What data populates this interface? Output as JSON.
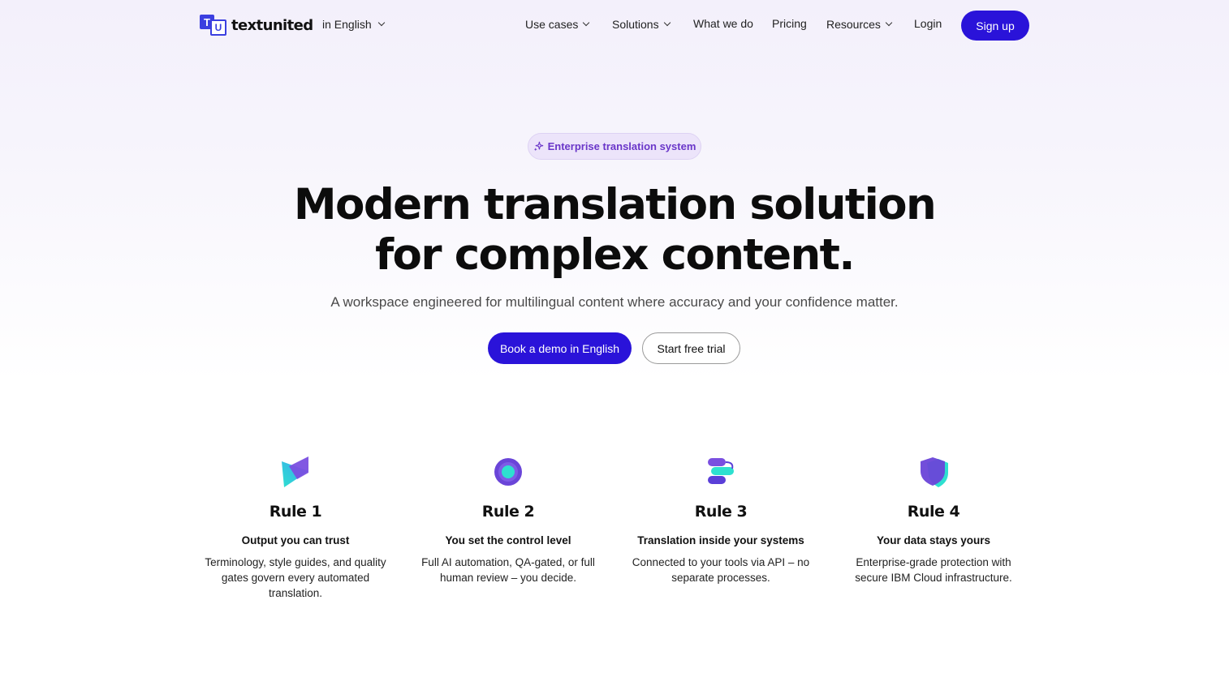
{
  "brand": {
    "logo_t": "T",
    "logo_u": "U",
    "name": "textunited"
  },
  "language_selector": "in English",
  "nav": {
    "use_cases": "Use cases",
    "solutions": "Solutions",
    "what_we_do": "What we do",
    "pricing": "Pricing",
    "resources": "Resources",
    "login": "Login",
    "signup": "Sign up"
  },
  "hero": {
    "badge": "Enterprise translation system",
    "title_line1": "Modern translation solution",
    "title_line2": "for complex content.",
    "subtitle": "A workspace engineered for multilingual content where accuracy and your confidence matter.",
    "primary_cta": "Book a demo in English",
    "secondary_cta": "Start free trial"
  },
  "rules": [
    {
      "title": "Rule 1",
      "subtitle": "Output you can trust",
      "description": "Terminology, style guides, and quality gates govern every automated translation.",
      "icon": "triangle-play-icon"
    },
    {
      "title": "Rule 2",
      "subtitle": "You set the control level",
      "description": "Full AI automation, QA-gated, or full human review – you decide.",
      "icon": "control-dial-icon"
    },
    {
      "title": "Rule 3",
      "subtitle": "Translation inside your systems",
      "description": "Connected to your tools via API – no separate processes.",
      "icon": "integration-icon"
    },
    {
      "title": "Rule 4",
      "subtitle": "Your data stays yours",
      "description": "Enterprise-grade protection with secure IBM Cloud infrastructure.",
      "icon": "shield-icon"
    }
  ],
  "colors": {
    "primary": "#2a13d9",
    "badge_text": "#6a36c9",
    "badge_bg": "#ece4fa",
    "icon_purple": "#7a4fe0",
    "icon_cyan": "#2ee0d0"
  }
}
